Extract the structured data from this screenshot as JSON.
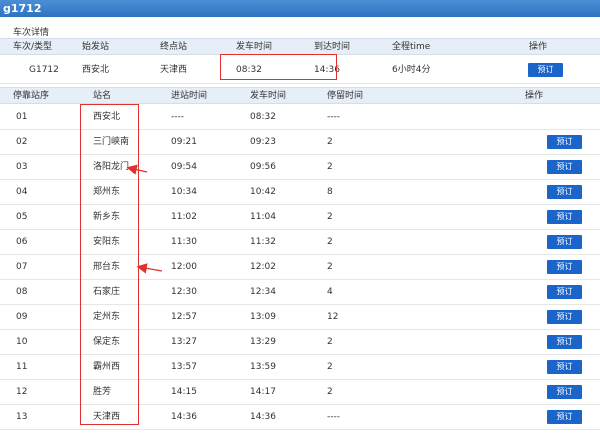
{
  "window": {
    "title": "g1712"
  },
  "section": {
    "title": "车次详情"
  },
  "summary": {
    "headers": {
      "train_type": "车次/类型",
      "origin": "始发站",
      "terminal": "终点站",
      "depart_time": "发车时间",
      "arrive_time": "到达时间",
      "duration": "全程time",
      "action": "操作"
    },
    "row": {
      "train": "G1712",
      "origin": "西安北",
      "terminal": "天津西",
      "depart_time": "08:32",
      "arrive_time": "14:36",
      "duration": "6小时4分",
      "book_label": "预订"
    }
  },
  "stops": {
    "headers": {
      "seq": "停靠站序",
      "station": "站名",
      "arrive": "进站时间",
      "depart": "发车时间",
      "stay": "停留时间",
      "action": "操作"
    },
    "book_label": "预订",
    "rows": [
      {
        "seq": "01",
        "station": "西安北",
        "arrive": "----",
        "depart": "08:32",
        "stay": "----",
        "book": false
      },
      {
        "seq": "02",
        "station": "三门峡南",
        "arrive": "09:21",
        "depart": "09:23",
        "stay": "2",
        "book": true
      },
      {
        "seq": "03",
        "station": "洛阳龙门",
        "arrive": "09:54",
        "depart": "09:56",
        "stay": "2",
        "book": true
      },
      {
        "seq": "04",
        "station": "郑州东",
        "arrive": "10:34",
        "depart": "10:42",
        "stay": "8",
        "book": true
      },
      {
        "seq": "05",
        "station": "新乡东",
        "arrive": "11:02",
        "depart": "11:04",
        "stay": "2",
        "book": true
      },
      {
        "seq": "06",
        "station": "安阳东",
        "arrive": "11:30",
        "depart": "11:32",
        "stay": "2",
        "book": true
      },
      {
        "seq": "07",
        "station": "邢台东",
        "arrive": "12:00",
        "depart": "12:02",
        "stay": "2",
        "book": true
      },
      {
        "seq": "08",
        "station": "石家庄",
        "arrive": "12:30",
        "depart": "12:34",
        "stay": "4",
        "book": true
      },
      {
        "seq": "09",
        "station": "定州东",
        "arrive": "12:57",
        "depart": "13:09",
        "stay": "12",
        "book": true
      },
      {
        "seq": "10",
        "station": "保定东",
        "arrive": "13:27",
        "depart": "13:29",
        "stay": "2",
        "book": true
      },
      {
        "seq": "11",
        "station": "霸州西",
        "arrive": "13:57",
        "depart": "13:59",
        "stay": "2",
        "book": true
      },
      {
        "seq": "12",
        "station": "胜芳",
        "arrive": "14:15",
        "depart": "14:17",
        "stay": "2",
        "book": true
      },
      {
        "seq": "13",
        "station": "天津西",
        "arrive": "14:36",
        "depart": "14:36",
        "stay": "----",
        "book": true
      }
    ]
  },
  "annotations": {
    "box_color": "#e03030",
    "arrow_rows": [
      "洛阳龙门",
      "邢台东"
    ]
  }
}
